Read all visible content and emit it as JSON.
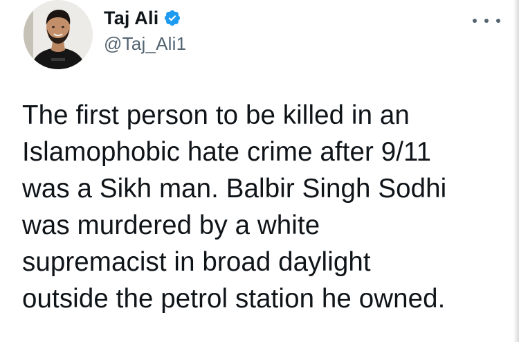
{
  "author": {
    "display_name": "Taj Ali",
    "handle": "@Taj_Ali1",
    "verified": true,
    "avatar_icon": "profile-photo"
  },
  "actions": {
    "more_icon": "more-options-icon"
  },
  "tweet": {
    "text": "The first person to be killed in an\nIslamophobic hate crime after 9/11\nwas a Sikh man. Balbir Singh Sodhi\nwas murdered by a white\nsupremacist in broad daylight\noutside the petrol station he owned."
  },
  "colors": {
    "text_primary": "#0f1419",
    "text_secondary": "#536471",
    "verified_blue": "#1d9bf0"
  }
}
